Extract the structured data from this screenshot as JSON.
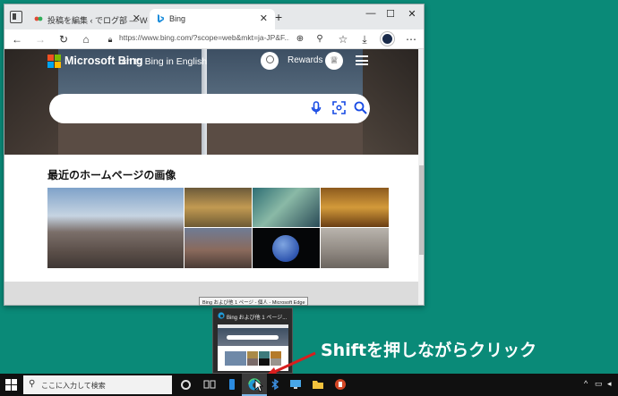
{
  "browser": {
    "tabs": [
      {
        "label": "投稿を編集 ‹ でログ部 — WordP",
        "active": false
      },
      {
        "label": "Bing",
        "active": true
      }
    ],
    "new_tab_symbol": "+",
    "window_controls": {
      "minimize": "—",
      "maximize": "☐",
      "close": "✕"
    },
    "url": "https://www.bing.com/?scope=web&mkt=ja-JP&F...",
    "toolbar_icons": [
      "back-icon",
      "forward-icon",
      "refresh-icon",
      "home-icon",
      "lock-icon",
      "zoom-icon",
      "tracking-icon",
      "favorites-icon",
      "download-icon",
      "profile-icon",
      "more-icon"
    ]
  },
  "bing": {
    "brand": "Microsoft Bing",
    "brand_overlay": "ch to Bing in English",
    "rewards_label": "Rewards",
    "rewards_icon": "♕",
    "section_title": "最近のホームページの画像"
  },
  "tooltip": "Bing および他 1 ページ - 個人 - Microsoft Edge",
  "preview": {
    "title": "Bing および他 1 ページ..."
  },
  "annotation": "Shiftを押しながらクリック",
  "taskbar": {
    "search_placeholder": "ここに入力して検索"
  },
  "colors": {
    "desktop": "#0a8a78",
    "accent": "#174ae4",
    "arrow": "#d81e1e"
  }
}
